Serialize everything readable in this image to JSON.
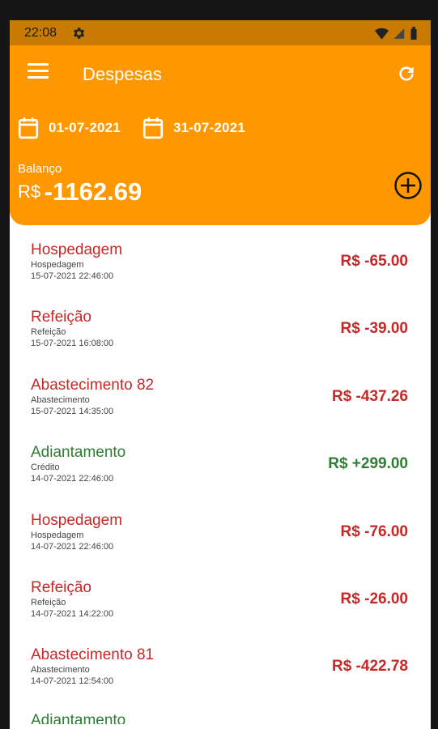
{
  "status_bar": {
    "time": "22:08"
  },
  "app": {
    "title": "Despesas",
    "date_from": "01-07-2021",
    "date_to": "31-07-2021",
    "balance_label": "Balanço",
    "balance_currency": "R$",
    "balance_value": "-1162.69"
  },
  "colors": {
    "header": "#ff9800",
    "negative": "#c62828",
    "positive": "#2e7d32"
  },
  "transactions": [
    {
      "title": "Hospedagem",
      "category": "Hospedagem",
      "datetime": "15-07-2021 22:46:00",
      "amount": "R$ -65.00",
      "type": "negative"
    },
    {
      "title": "Refeição",
      "category": "Refeição",
      "datetime": "15-07-2021 16:08:00",
      "amount": "R$ -39.00",
      "type": "negative"
    },
    {
      "title": "Abastecimento 82",
      "category": "Abastecimento",
      "datetime": "15-07-2021 14:35:00",
      "amount": "R$ -437.26",
      "type": "negative"
    },
    {
      "title": "Adiantamento",
      "category": "Crédito",
      "datetime": "14-07-2021 22:46:00",
      "amount": "R$ +299.00",
      "type": "positive"
    },
    {
      "title": "Hospedagem",
      "category": "Hospedagem",
      "datetime": "14-07-2021 22:46:00",
      "amount": "R$ -76.00",
      "type": "negative"
    },
    {
      "title": "Refeição",
      "category": "Refeição",
      "datetime": "14-07-2021 14:22:00",
      "amount": "R$ -26.00",
      "type": "negative"
    },
    {
      "title": "Abastecimento 81",
      "category": "Abastecimento",
      "datetime": "14-07-2021 12:54:00",
      "amount": "R$ -422.78",
      "type": "negative"
    }
  ],
  "partial_item": {
    "title": "Adiantamento"
  }
}
